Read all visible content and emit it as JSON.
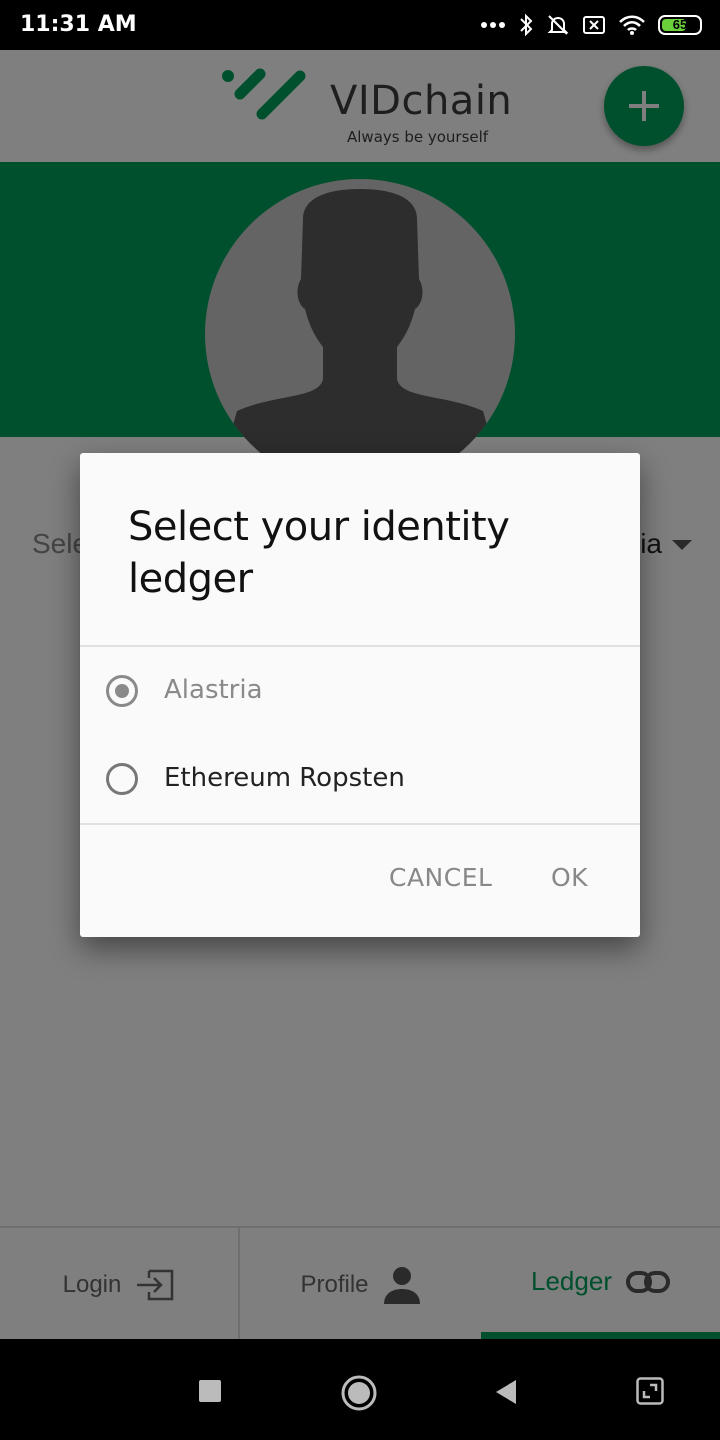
{
  "status_bar": {
    "time": "11:31 AM",
    "battery": "65",
    "icons": [
      "more-dots-icon",
      "bluetooth-icon",
      "mute-bell-icon",
      "sim-x-icon",
      "wifi-icon",
      "battery-icon"
    ]
  },
  "header": {
    "logo_title": "VIDchain",
    "logo_subtitle": "Always be yourself"
  },
  "select": {
    "label": "Sele",
    "value": "ia"
  },
  "dialog": {
    "title": "Select your identity ledger",
    "options": [
      {
        "label": "Alastria",
        "selected": true
      },
      {
        "label": "Ethereum Ropsten",
        "selected": false
      }
    ],
    "cancel_label": "CANCEL",
    "ok_label": "OK"
  },
  "bottom_nav": {
    "items": [
      {
        "label": "Login",
        "icon": "login-icon"
      },
      {
        "label": "Profile",
        "icon": "person-icon"
      },
      {
        "label": "Ledger",
        "icon": "link-icon",
        "active": true
      }
    ]
  },
  "colors": {
    "brand": "#00a05a",
    "scrim": "rgba(0,0,0,0.5)"
  }
}
